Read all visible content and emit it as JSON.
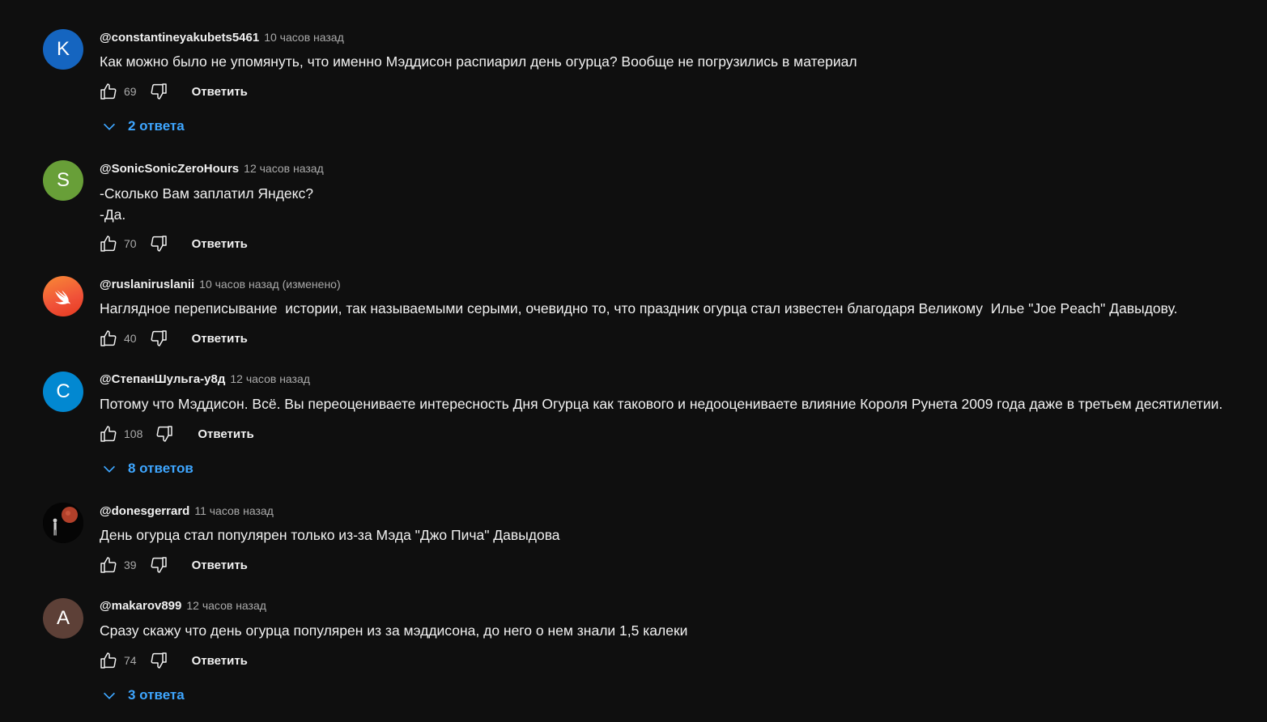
{
  "colors": {
    "background": "#0f0f0f",
    "text_primary": "#f1f1f1",
    "text_secondary": "#aaaaaa",
    "accent_link": "#3ea6ff"
  },
  "reply_label": "Ответить",
  "comments": [
    {
      "author": "@constantineyakubets5461",
      "time": "10 часов назад",
      "avatar_letter": "K",
      "avatar_color": "#1565c0",
      "lines": [
        "Как можно было не упомянуть, что именно Мэддисон распиарил день огурца? Вообще не погрузились в материал"
      ],
      "likes": "69",
      "replies": "2 ответа"
    },
    {
      "author": "@SonicSonicZeroHours",
      "time": "12 часов назад",
      "avatar_letter": "S",
      "avatar_color": "#689f38",
      "lines": [
        "-Сколько Вам заплатил Яндекс?",
        "-Да."
      ],
      "likes": "70"
    },
    {
      "author": "@ruslaniruslanii",
      "time": "10 часов назад (изменено)",
      "avatar_icon": "swift-logo-icon",
      "avatar_color": "#f05138",
      "lines": [
        "Наглядное переписывание  истории, так называемыми серыми, очевидно то, что праздник огурца стал известен благодаря Великому  Илье \"Joe Peach\" Давыдову."
      ],
      "likes": "40"
    },
    {
      "author": "@СтепанШульга-у8д",
      "time": "12 часов назад",
      "avatar_letter": "С",
      "avatar_color": "#0288d1",
      "lines": [
        "Потому что Мэддисон. Всё. Вы переоцениваете интересность Дня Огурца как такового и недооцениваете влияние Короля Рунета 2009 года даже в третьем десятилетии."
      ],
      "likes": "108",
      "replies": "8 ответов"
    },
    {
      "author": "@donesgerrard",
      "time": "11 часов назад",
      "avatar_icon": "moon-figure-avatar-icon",
      "avatar_color": "#000000",
      "lines": [
        "День огурца стал популярен только из-за Мэда \"Джо Пича\" Давыдова"
      ],
      "likes": "39"
    },
    {
      "author": "@makarov899",
      "time": "12 часов назад",
      "avatar_letter": "A",
      "avatar_color": "#5d4037",
      "lines": [
        "Сразу скажу что день огурца популярен из за мэддисона, до него о нем знали 1,5 калеки"
      ],
      "likes": "74",
      "replies": "3 ответа"
    }
  ]
}
